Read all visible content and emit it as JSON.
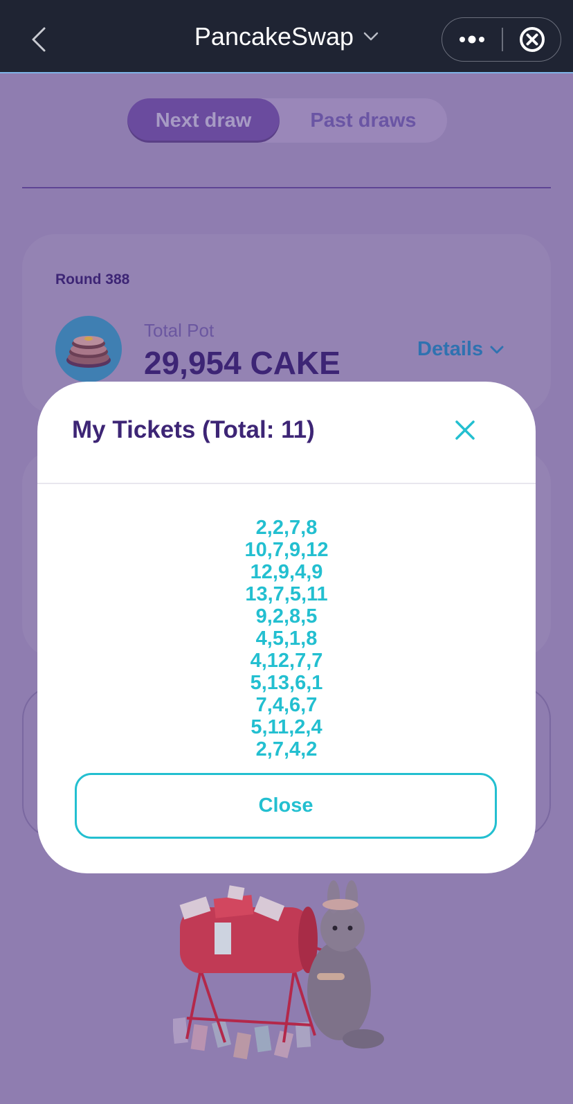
{
  "app": {
    "title": "PancakeSwap"
  },
  "tabs": {
    "next_label": "Next draw",
    "past_label": "Past draws",
    "active": "Next draw"
  },
  "round_card": {
    "round_label": "Round 388",
    "pot_label": "Total Pot",
    "pot_value": "29,954 CAKE",
    "details_label": "Details"
  },
  "modal": {
    "title": "My Tickets (Total: 11)",
    "tickets": [
      "2,2,7,8",
      "10,7,9,12",
      "12,9,4,9",
      "13,7,5,11",
      "9,2,8,5",
      "4,5,1,8",
      "4,12,7,7",
      "5,13,6,1",
      "7,4,6,7",
      "5,11,2,4",
      "2,7,4,2"
    ],
    "close_label": "Close"
  },
  "icons": {
    "back": "chevron-left-icon",
    "title_dropdown": "chevron-down-icon",
    "more": "more-dots-icon",
    "close_app": "circle-close-icon",
    "modal_close": "close-icon",
    "details": "chevron-down-icon",
    "cake": "cake-logo"
  },
  "colors": {
    "top_bar": "#1f2433",
    "overlay_background": "#8f7db0",
    "primary_purple": "#3d2575",
    "accent_teal": "#23bfd0",
    "details_blue": "#2f72b0"
  }
}
